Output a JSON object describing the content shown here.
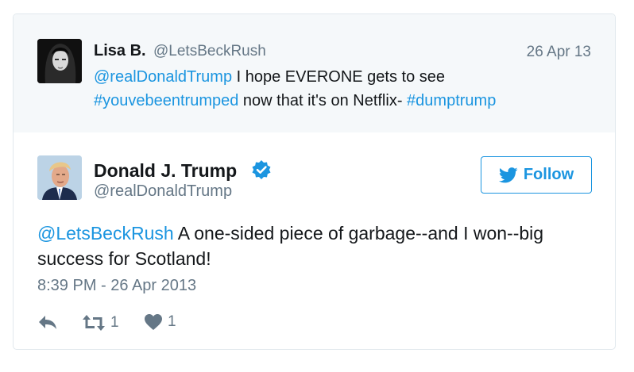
{
  "reply_to": {
    "name": "Lisa B.",
    "handle": "@LetsBeckRush",
    "date": "26 Apr 13",
    "text_parts": [
      {
        "text": "@realDonaldTrump",
        "link": true
      },
      {
        "text": " I hope EVERONE gets to see ",
        "link": false
      },
      {
        "text": "#youvebeentrumped",
        "link": true
      },
      {
        "text": " now that it's on Netflix- ",
        "link": false
      },
      {
        "text": "#dumptrump",
        "link": true
      }
    ]
  },
  "tweet": {
    "name": "Donald J. Trump",
    "handle": "@realDonaldTrump",
    "verified_icon": "verified-badge-icon",
    "follow_label": "Follow",
    "mention": "@LetsBeckRush",
    "text": " A one-sided piece of garbage--and I won--big success for Scotland!",
    "timestamp": "8:39 PM - 26 Apr 2013",
    "retweet_count": "1",
    "like_count": "1"
  },
  "colors": {
    "link": "#1b95e0",
    "muted": "#657786",
    "reply_background": "#f5f8fa"
  }
}
